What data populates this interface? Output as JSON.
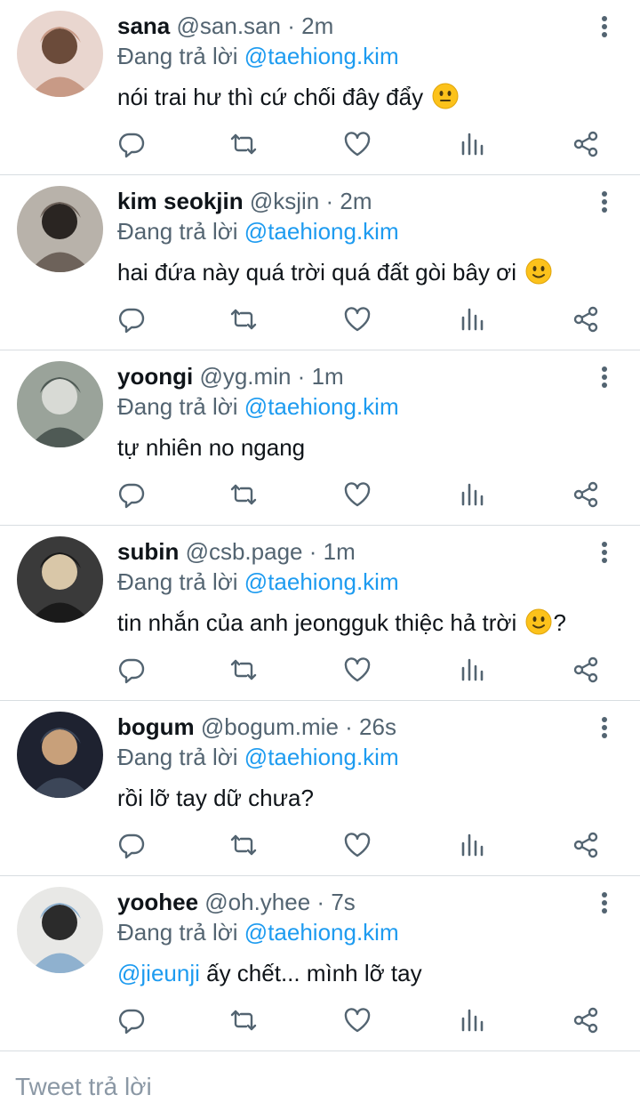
{
  "replies": [
    {
      "name": "sana",
      "handle": "@san.san",
      "dot": "·",
      "time": "2m",
      "replying_prefix": "Đang trả lời",
      "replying_to": "@taehiong.kim",
      "text": "nói trai hư thì cứ chối đây đẩy",
      "mention": "",
      "trailing": "",
      "emoji": "neutral-face",
      "avatar_colors": [
        "#e9d6cf",
        "#c89a86",
        "#6b4b3a"
      ]
    },
    {
      "name": "kim seokjin",
      "handle": "@ksjin",
      "dot": "·",
      "time": "2m",
      "replying_prefix": "Đang trả lời",
      "replying_to": "@taehiong.kim",
      "text": "hai đứa này quá trời quá đất gòi bây ơi",
      "mention": "",
      "trailing": "",
      "emoji": "slight-smile",
      "avatar_colors": [
        "#b8b2aa",
        "#6d625a",
        "#2a2522"
      ]
    },
    {
      "name": "yoongi",
      "handle": "@yg.min",
      "dot": "·",
      "time": "1m",
      "replying_prefix": "Đang trả lời",
      "replying_to": "@taehiong.kim",
      "text": "tự nhiên no ngang",
      "mention": "",
      "trailing": "",
      "emoji": "",
      "avatar_colors": [
        "#9aa39a",
        "#4f5a55",
        "#d8dad5"
      ]
    },
    {
      "name": "subin",
      "handle": "@csb.page",
      "dot": "·",
      "time": "1m",
      "replying_prefix": "Đang trả lời",
      "replying_to": "@taehiong.kim",
      "text": "tin nhắn của anh jeongguk thiệc hả trời",
      "mention": "",
      "trailing": "?",
      "emoji": "slight-smile",
      "avatar_colors": [
        "#3a3a3a",
        "#1a1a1a",
        "#d9c7a8"
      ]
    },
    {
      "name": "bogum",
      "handle": "@bogum.mie",
      "dot": "·",
      "time": "26s",
      "replying_prefix": "Đang trả lời",
      "replying_to": "@taehiong.kim",
      "text": "rồi lỡ tay dữ chưa?",
      "mention": "",
      "trailing": "",
      "emoji": "",
      "avatar_colors": [
        "#1e2230",
        "#3c4658",
        "#c8a07a"
      ]
    },
    {
      "name": "yoohee",
      "handle": "@oh.yhee",
      "dot": "·",
      "time": "7s",
      "replying_prefix": "Đang trả lời",
      "replying_to": "@taehiong.kim",
      "text": " ấy chết... mình lỡ tay",
      "mention": "@jieunji",
      "trailing": "",
      "emoji": "",
      "avatar_colors": [
        "#e8e8e6",
        "#8fb1cf",
        "#2b2b2b"
      ]
    }
  ],
  "compose": {
    "placeholder": "Tweet trả lời"
  },
  "colors": {
    "accent": "#1d9bf0",
    "secondary_text": "#536471",
    "primary_text": "#0f1419",
    "divider": "#d8dde1"
  },
  "icons": [
    "reply-icon",
    "retweet-icon",
    "like-icon",
    "views-icon",
    "share-icon",
    "more-icon"
  ]
}
